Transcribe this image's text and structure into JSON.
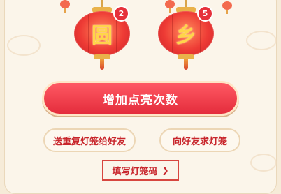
{
  "lanterns": [
    {
      "char": "圆",
      "count": "2"
    },
    {
      "char": "乡",
      "count": "5"
    }
  ],
  "actions": {
    "primary_label": "增加点亮次数",
    "send_duplicate_label": "送重复灯笼给好友",
    "ask_friends_label": "向好友求灯笼",
    "enter_code_label": "填写灯笼码"
  },
  "icons": {
    "chevron": "chevron-right-icon"
  },
  "colors": {
    "primary": "#e42c3c",
    "accent_text": "#c8262c",
    "background": "#fbf5ea"
  }
}
